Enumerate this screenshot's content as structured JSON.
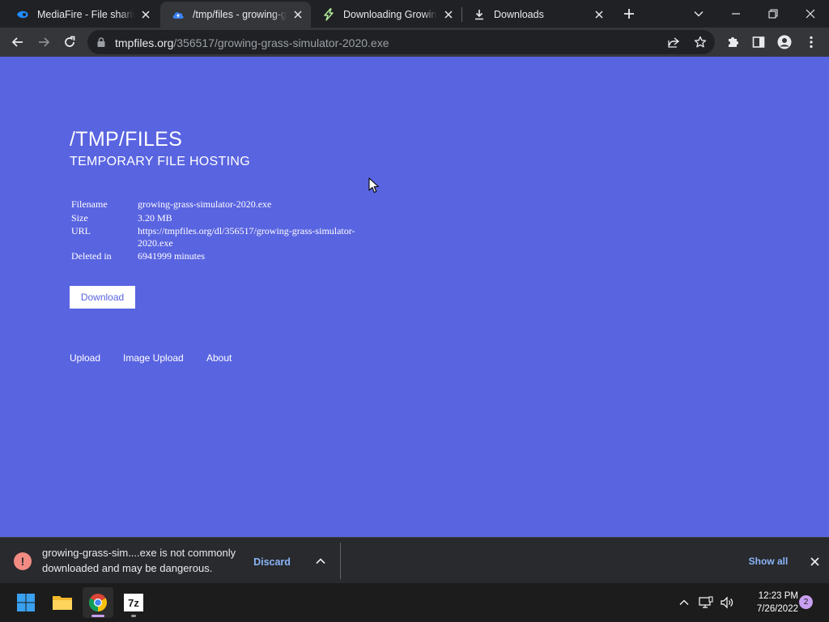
{
  "browser": {
    "tabs": [
      {
        "title": "MediaFire - File sharing",
        "active": false,
        "favicon": "mediafire-icon"
      },
      {
        "title": "/tmp/files - growing-grass",
        "active": true,
        "favicon": "tmpfiles-cloud-icon"
      },
      {
        "title": "Downloading Growing",
        "active": false,
        "favicon": "growing-bolt-icon"
      },
      {
        "title": "Downloads",
        "active": false,
        "favicon": "download-icon"
      }
    ],
    "address": {
      "host": "tmpfiles.org",
      "path": "/356517/growing-grass-simulator-2020.exe"
    }
  },
  "page": {
    "background": "#5964e0",
    "title": "/TMP/FILES",
    "subtitle": "TEMPORARY FILE HOSTING",
    "info": {
      "filename_label": "Filename",
      "filename": "growing-grass-simulator-2020.exe",
      "size_label": "Size",
      "size": "3.20 MB",
      "url_label": "URL",
      "url": "https://tmpfiles.org/dl/356517/growing-grass-simulator-2020.exe",
      "deleted_label": "Deleted in",
      "deleted": "6941999 minutes"
    },
    "download_label": "Download",
    "footer_links": [
      "Upload",
      "Image Upload",
      "About"
    ]
  },
  "download_bar": {
    "message": "growing-grass-sim....exe is not commonly downloaded and may be dangerous.",
    "discard_label": "Discard",
    "show_all_label": "Show all"
  },
  "taskbar": {
    "apps": [
      "start-icon",
      "file-explorer-icon",
      "chrome-icon",
      "7zip-icon"
    ],
    "time": "12:23 PM",
    "date": "7/26/2022",
    "notification_count": "2"
  }
}
